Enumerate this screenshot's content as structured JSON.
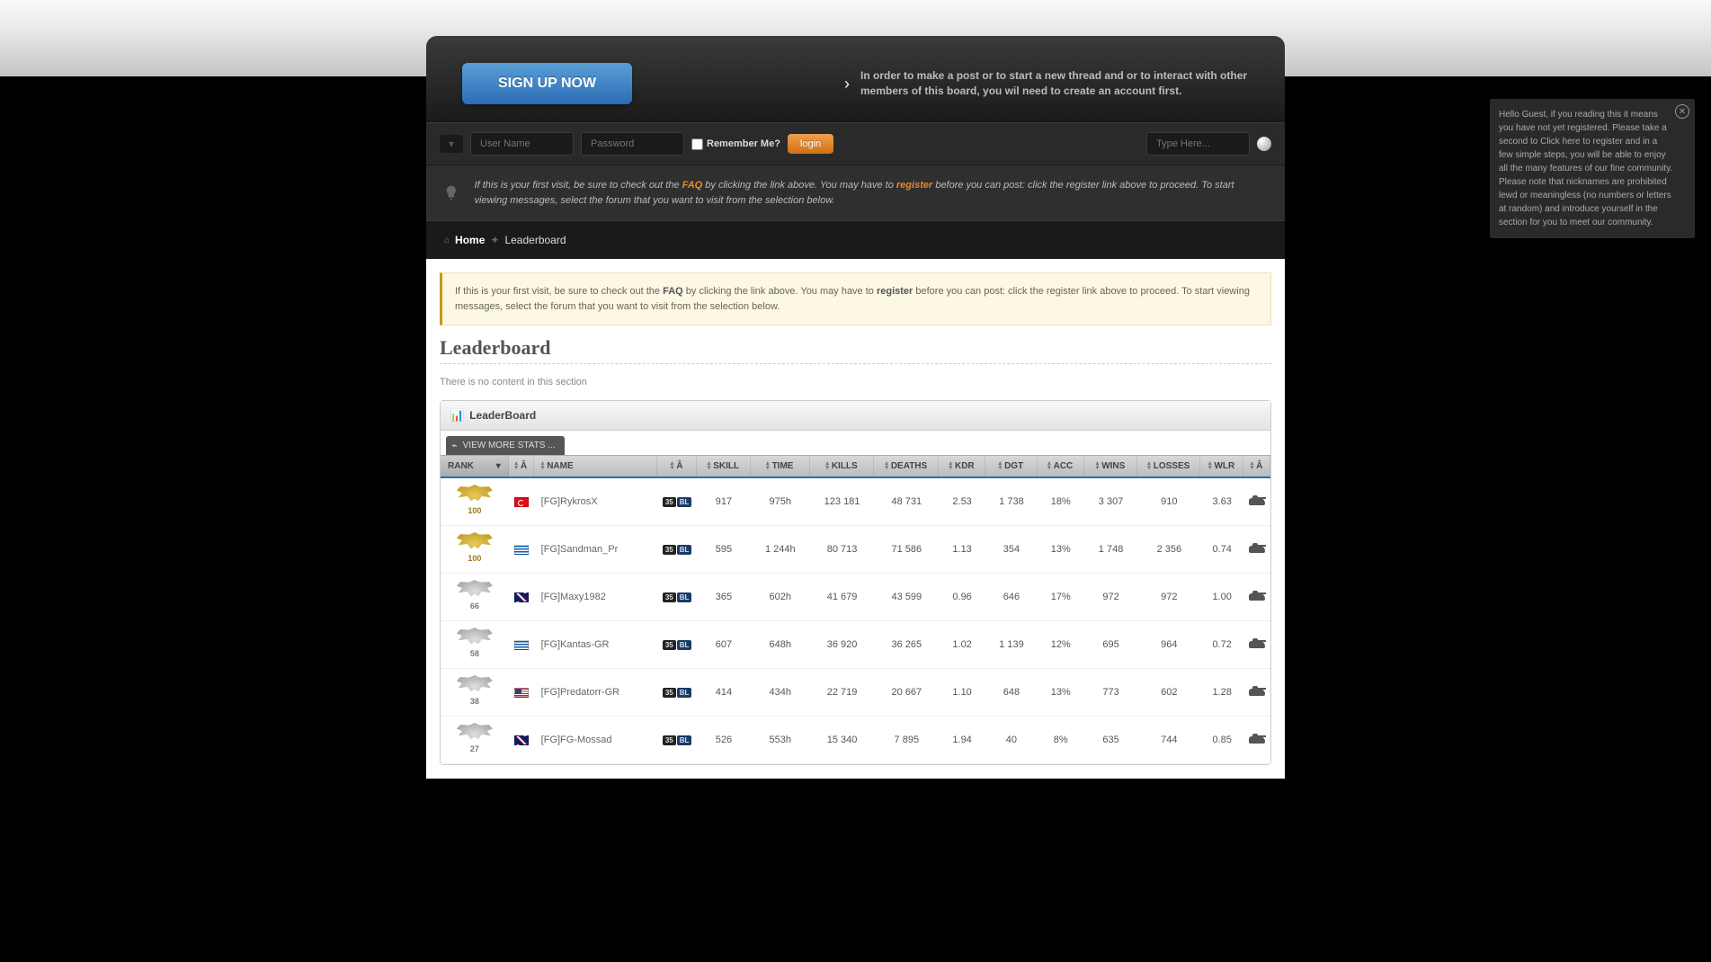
{
  "signup_label": "SIGN UP NOW",
  "header_msg": "In order to make a post or to start a new thread and or to interact with other members of this board, you wil need to create an account first.",
  "login": {
    "user_ph": "User Name",
    "pass_ph": "Password",
    "remember": "Remember Me?",
    "login_label": "login",
    "search_ph": "Type Here..."
  },
  "visit_notice": {
    "pre": "If this is your first visit, be sure to check out the ",
    "faq": "FAQ",
    "mid": " by clicking the link above. You may have to ",
    "reg": "register",
    "post": " before you can post: click the register link above to proceed. To start viewing messages, select the forum that you want to visit from the selection below."
  },
  "breadcrumb": {
    "home": "Home",
    "current": "Leaderboard"
  },
  "yellow_notice": {
    "pre": "If this is your first visit, be sure to check out the ",
    "faq": "FAQ",
    "mid": " by clicking the link above. You may have to ",
    "reg": "register",
    "post": " before you can post: click the register link above to proceed. To start viewing messages, select the forum that you want to visit from the selection below."
  },
  "page_title": "Leaderboard",
  "no_content": "There is no content in this section",
  "board_title": "LeaderBoard",
  "view_more": "VIEW MORE STATS ...",
  "columns": {
    "rank": "RANK",
    "flag": "Â",
    "name": "NAME",
    "badge": "Â",
    "skill": "SKILL",
    "time": "TIME",
    "kills": "KILLS",
    "deaths": "DEATHS",
    "kdr": "KDR",
    "dgt": "DGT",
    "acc": "ACC",
    "wins": "WINS",
    "losses": "LOSSES",
    "wlr": "WLR",
    "tank": "Â"
  },
  "rows": [
    {
      "rank_style": "gold",
      "rank_num": "100",
      "flag": "tr",
      "name": "[FG]RykrosX",
      "skill": "917",
      "time": "975h",
      "kills": "123 181",
      "deaths": "48 731",
      "kdr": "2.53",
      "dgt": "1 738",
      "acc": "18%",
      "wins": "3 307",
      "losses": "910",
      "wlr": "3.63"
    },
    {
      "rank_style": "gold",
      "rank_num": "100",
      "flag": "gr",
      "name": "[FG]Sandman_Pr",
      "skill": "595",
      "time": "1 244h",
      "kills": "80 713",
      "deaths": "71 586",
      "kdr": "1.13",
      "dgt": "354",
      "acc": "13%",
      "wins": "1 748",
      "losses": "2 356",
      "wlr": "0.74"
    },
    {
      "rank_style": "silver",
      "rank_num": "66",
      "flag": "gb",
      "name": "[FG]Maxy1982",
      "skill": "365",
      "time": "602h",
      "kills": "41 679",
      "deaths": "43 599",
      "kdr": "0.96",
      "dgt": "646",
      "acc": "17%",
      "wins": "972",
      "losses": "972",
      "wlr": "1.00"
    },
    {
      "rank_style": "silver",
      "rank_num": "58",
      "flag": "gr",
      "name": "[FG]Kantas-GR",
      "skill": "607",
      "time": "648h",
      "kills": "36 920",
      "deaths": "36 265",
      "kdr": "1.02",
      "dgt": "1 139",
      "acc": "12%",
      "wins": "695",
      "losses": "964",
      "wlr": "0.72"
    },
    {
      "rank_style": "silver",
      "rank_num": "38",
      "flag": "us",
      "name": "[FG]Predatorr-GR",
      "skill": "414",
      "time": "434h",
      "kills": "22 719",
      "deaths": "20 667",
      "kdr": "1.10",
      "dgt": "648",
      "acc": "13%",
      "wins": "773",
      "losses": "602",
      "wlr": "1.28"
    },
    {
      "rank_style": "silver",
      "rank_num": "27",
      "flag": "gb",
      "name": "[FG]FG-Mossad",
      "skill": "526",
      "time": "553h",
      "kills": "15 340",
      "deaths": "7 895",
      "kdr": "1.94",
      "dgt": "40",
      "acc": "8%",
      "wins": "635",
      "losses": "744",
      "wlr": "0.85"
    }
  ],
  "popup": {
    "text": "Hello Guest, if you reading this it means you have not yet registered. Please take a second to Click here to register and in a few simple steps, you will be able to enjoy all the many features of our fine community. Please note that nicknames are prohibited lewd or meaningless (no numbers or letters at random) and introduce yourself in the section for you to meet our community."
  }
}
